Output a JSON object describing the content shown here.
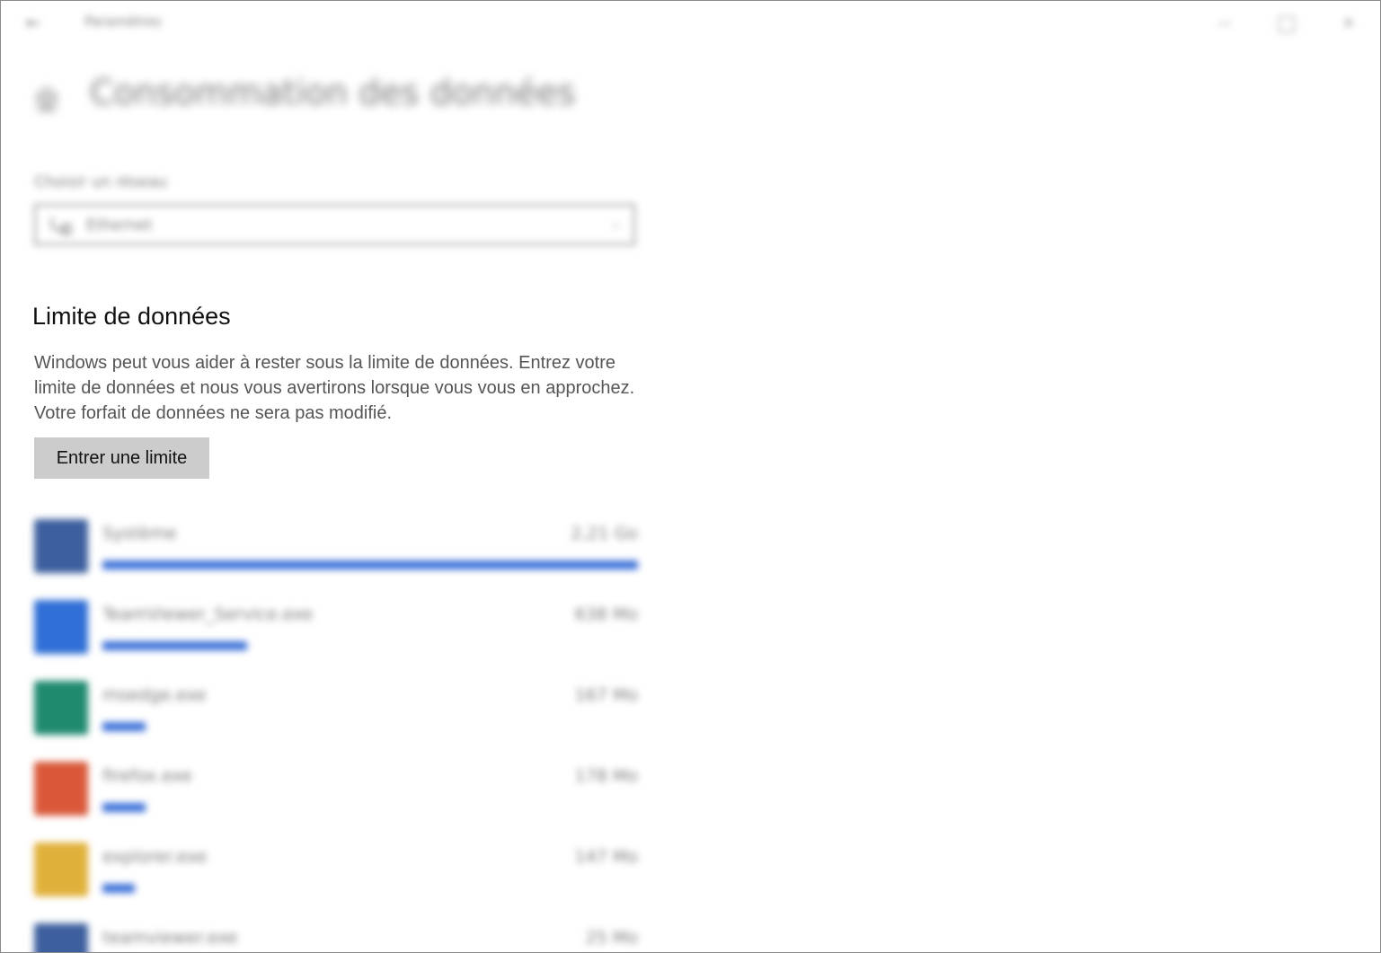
{
  "window": {
    "title": "Paramètres",
    "back_label": "←",
    "minimize_label": "—",
    "close_label": "✕"
  },
  "header": {
    "title": "Consommation des données",
    "icon": "home-icon"
  },
  "network": {
    "label": "Choisir un réseau",
    "selected": "Ethernet",
    "icon": "ethernet-icon"
  },
  "data_limit": {
    "title": "Limite de données",
    "description": "Windows peut vous aider à rester sous la limite de données. Entrez votre limite de données et nous vous avertirons lorsque vous vous en approchez. Votre forfait de données ne sera pas modifié.",
    "button_label": "Entrer une limite"
  },
  "accent_color": "#3a6fd8",
  "usage": [
    {
      "name": "Système",
      "size": "2,21 Go",
      "fraction": 1.0,
      "icon": "system-icon",
      "color": "#3d5f9e"
    },
    {
      "name": "TeamViewer_Service.exe",
      "size": "638 Mo",
      "fraction": 0.27,
      "icon": "teamviewer-icon",
      "color": "#2f6fd6"
    },
    {
      "name": "msedge.exe",
      "size": "167 Mo",
      "fraction": 0.08,
      "icon": "edge-icon",
      "color": "#1f8a6e"
    },
    {
      "name": "firefox.exe",
      "size": "178 Mo",
      "fraction": 0.08,
      "icon": "firefox-icon",
      "color": "#d9583a"
    },
    {
      "name": "explorer.exe",
      "size": "147 Mo",
      "fraction": 0.06,
      "icon": "explorer-icon",
      "color": "#e0b13a"
    },
    {
      "name": "teamviewer.exe",
      "size": "25 Mo",
      "fraction": 0.02,
      "icon": "teamviewer-icon",
      "color": "#3d5f9e"
    }
  ]
}
